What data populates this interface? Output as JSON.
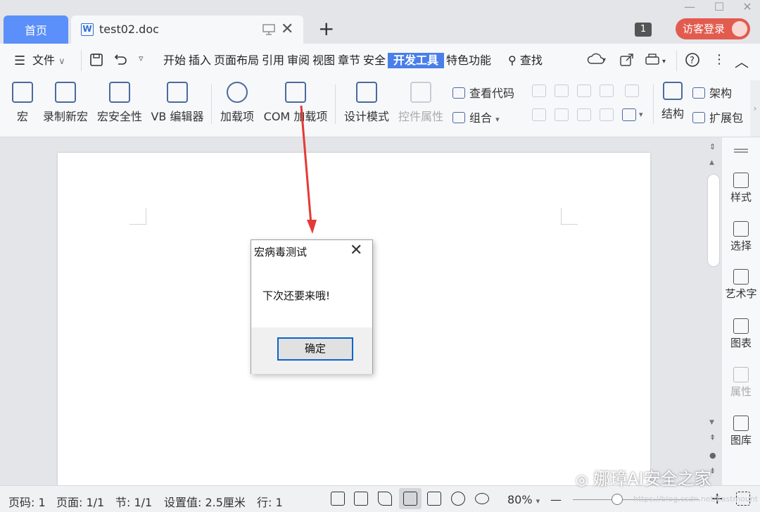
{
  "tabs": {
    "home": "首页",
    "doc": "test02.doc",
    "doc_icon": "W",
    "new_tab": "+"
  },
  "window": {
    "badge": "1",
    "login": "访客登录"
  },
  "menu": {
    "file": "文件",
    "items": [
      "开始",
      "插入",
      "页面布局",
      "引用",
      "审阅",
      "视图",
      "章节",
      "安全",
      "开发工具",
      "特色功能"
    ],
    "active": "开发工具",
    "search": "查找"
  },
  "ribbon": {
    "tools": [
      {
        "label": "宏",
        "icon": "macro-icon"
      },
      {
        "label": "录制新宏",
        "icon": "record-macro-icon"
      },
      {
        "label": "宏安全性",
        "icon": "macro-security-icon"
      },
      {
        "label": "VB 编辑器",
        "icon": "vb-editor-icon"
      },
      {
        "label": "加载项",
        "icon": "addin-gear-icon"
      },
      {
        "label": "COM 加载项",
        "icon": "com-addin-icon"
      },
      {
        "label": "设计模式",
        "icon": "design-mode-icon"
      },
      {
        "label": "控件属性",
        "icon": "control-props-icon"
      }
    ],
    "view_code": "查看代码",
    "group": "组合",
    "structure": "结构",
    "framework": "架构",
    "extension": "扩展包"
  },
  "dialog": {
    "title": "宏病毒测试",
    "message": "下次还要来哦!",
    "ok": "确定"
  },
  "side": {
    "items": [
      "样式",
      "选择",
      "艺术字",
      "图表",
      "属性",
      "图库"
    ],
    "disabled": [
      "属性"
    ]
  },
  "status": {
    "page_code": "页码: 1",
    "pages": "页面: 1/1",
    "section": "节: 1/1",
    "setting": "设置值: 2.5厘米",
    "row": "行: 1",
    "zoom": "80%",
    "zoom_minus": "—",
    "zoom_plus": "+",
    "zoom_level": 0.35
  },
  "watermark": {
    "text": "娜璋AI安全之家",
    "sub": "https://blog.csdn.net/Eastmount"
  },
  "colors": {
    "accent": "#5b8ff9",
    "active_tab": "#4a7fea",
    "login": "#e25b4f",
    "arrow": "#e53935",
    "dialog_button_border": "#0a64c8"
  }
}
